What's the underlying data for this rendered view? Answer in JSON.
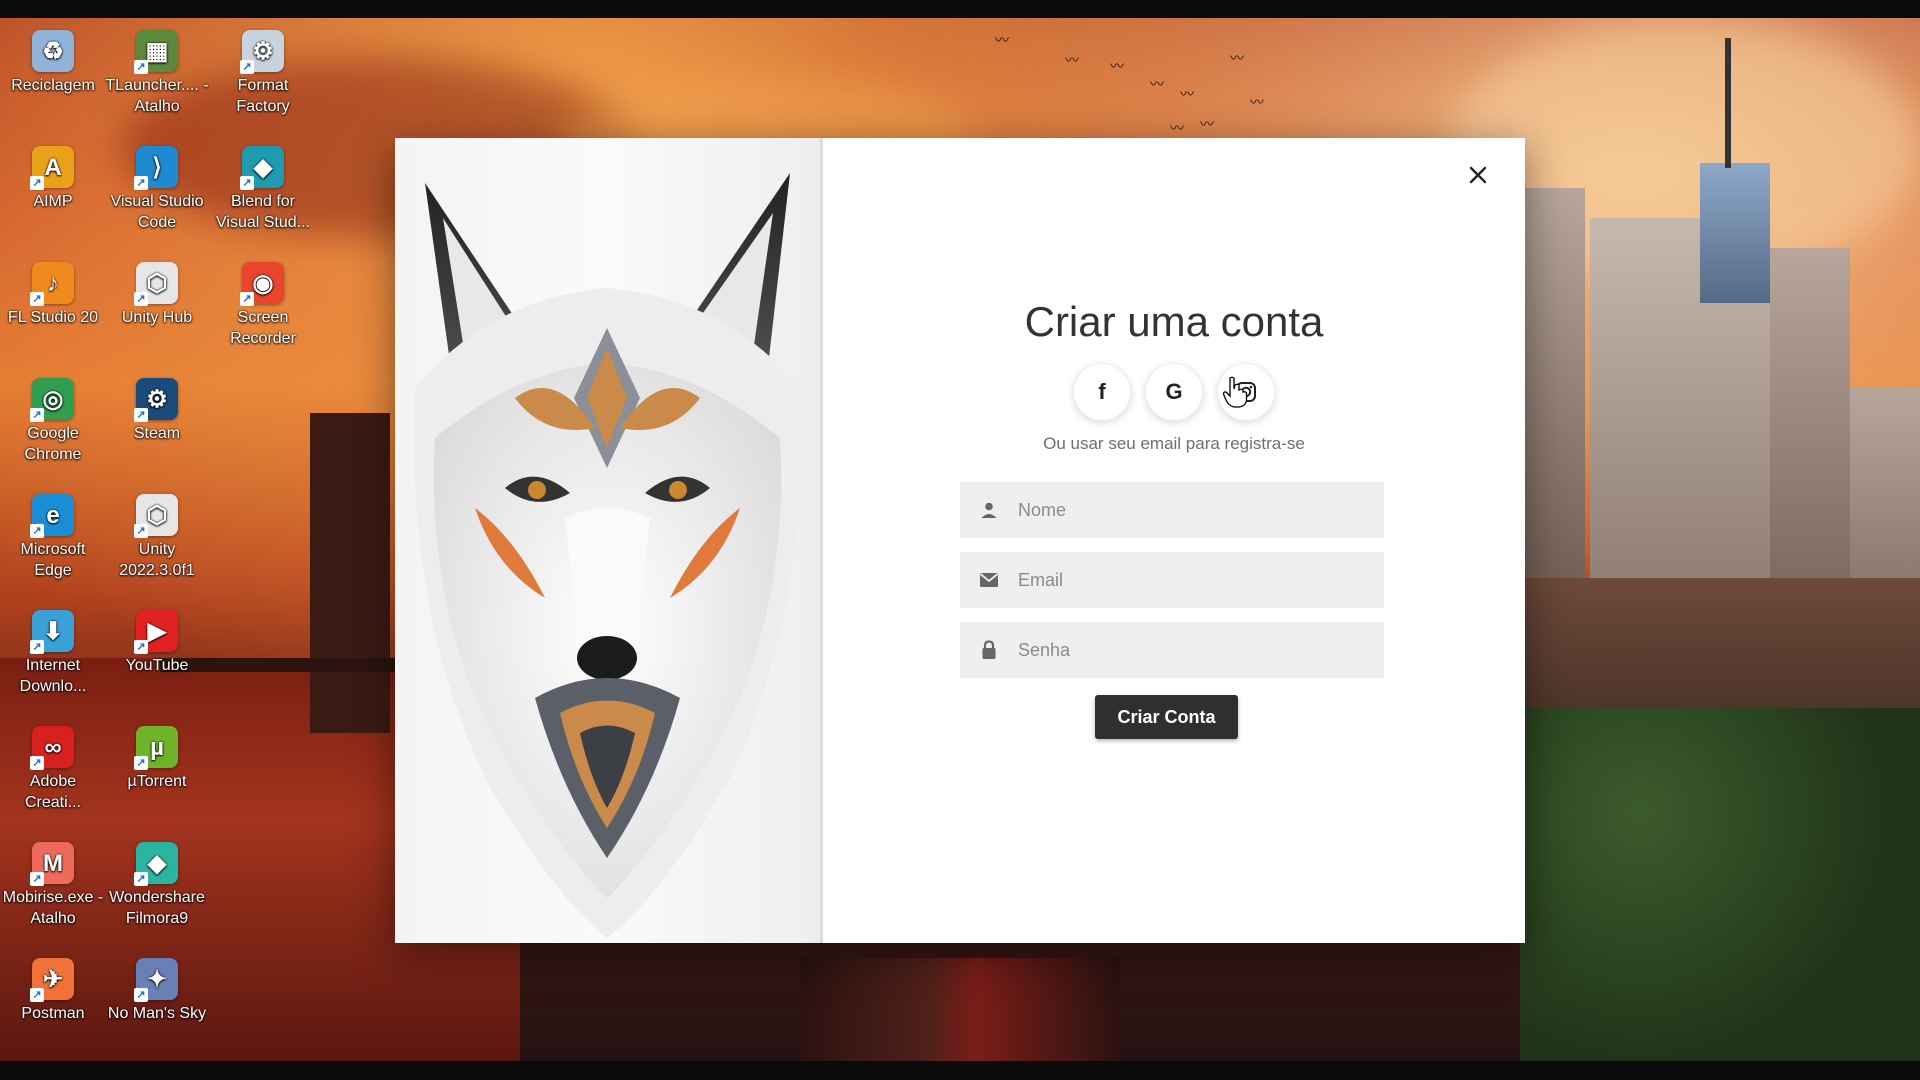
{
  "desktop": {
    "icons": [
      {
        "label": "Reciclagem",
        "icon": "recycle-bin-icon",
        "color": "#8fb3d9",
        "glyph": "♻"
      },
      {
        "label": "TLauncher.... - Atalho",
        "icon": "minecraft-icon",
        "color": "#5d8a3a",
        "glyph": "▦"
      },
      {
        "label": "Format Factory",
        "icon": "format-factory-icon",
        "color": "#c9d3de",
        "glyph": "⚙"
      },
      {
        "label": "AIMP",
        "icon": "aimp-icon",
        "color": "#e8a21a",
        "glyph": "A"
      },
      {
        "label": "Visual Studio Code",
        "icon": "vscode-icon",
        "color": "#1f8ad2",
        "glyph": "⟩"
      },
      {
        "label": "Blend for Visual Stud...",
        "icon": "blend-icon",
        "color": "#1e9bb0",
        "glyph": "◆"
      },
      {
        "label": "FL Studio 20",
        "icon": "fl-studio-icon",
        "color": "#f08a1c",
        "glyph": "♪"
      },
      {
        "label": "Unity Hub",
        "icon": "unity-hub-icon",
        "color": "#e6e6e6",
        "glyph": "⬡"
      },
      {
        "label": "Screen Recorder",
        "icon": "screen-recorder-icon",
        "color": "#e8452c",
        "glyph": "◉"
      },
      {
        "label": "Google Chrome",
        "icon": "chrome-icon",
        "color": "#2f9e4f",
        "glyph": "◎"
      },
      {
        "label": "Steam",
        "icon": "steam-icon",
        "color": "#1b4b7a",
        "glyph": "⚙"
      },
      {
        "label": "Microsoft Edge",
        "icon": "edge-icon",
        "color": "#1b8fd6",
        "glyph": "e"
      },
      {
        "label": "Unity 2022.3.0f1",
        "icon": "unity-icon",
        "color": "#e6e6e6",
        "glyph": "⬡"
      },
      {
        "label": "Internet Downlo...",
        "icon": "internet-download-manager-icon",
        "color": "#3aa0d8",
        "glyph": "⬇"
      },
      {
        "label": "YouTube",
        "icon": "youtube-icon",
        "color": "#e22222",
        "glyph": "▶"
      },
      {
        "label": "Adobe Creati...",
        "icon": "adobe-creative-cloud-icon",
        "color": "#d8201e",
        "glyph": "∞"
      },
      {
        "label": "µTorrent",
        "icon": "utorrent-icon",
        "color": "#6fb32b",
        "glyph": "µ"
      },
      {
        "label": "Mobirise.exe - Atalho",
        "icon": "mobirise-icon",
        "color": "#ee6a5c",
        "glyph": "M"
      },
      {
        "label": "Wondershare Filmora9",
        "icon": "filmora-icon",
        "color": "#2bb5a0",
        "glyph": "◆"
      },
      {
        "label": "Postman",
        "icon": "postman-icon",
        "color": "#f07238",
        "glyph": "✈"
      },
      {
        "label": "No Man's Sky",
        "icon": "no-mans-sky-icon",
        "color": "#6a7fb5",
        "glyph": "✦"
      }
    ]
  },
  "modal": {
    "title": "Criar uma conta",
    "socials": [
      {
        "name": "facebook",
        "glyph": "f"
      },
      {
        "name": "google",
        "glyph": "G"
      },
      {
        "name": "instagram",
        "glyph": "◙"
      }
    ],
    "subtitle": "Ou usar seu email para registra-se",
    "fields": {
      "name_placeholder": "Nome",
      "email_placeholder": "Email",
      "password_placeholder": "Senha"
    },
    "submit_label": "Criar Conta"
  }
}
